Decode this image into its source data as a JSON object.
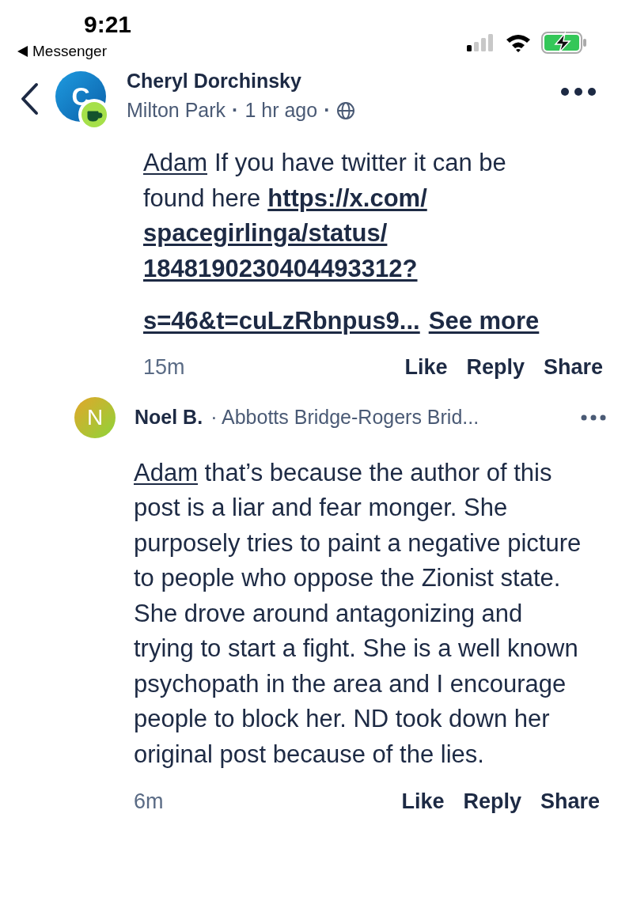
{
  "status_bar": {
    "time": "9:21",
    "back_app": "Messenger"
  },
  "post_header": {
    "avatar_letter": "C",
    "author": "Cheryl Dorchinsky",
    "location": "Milton Park",
    "separator_1": "·",
    "time": "1 hr ago",
    "separator_2": "·"
  },
  "comments": [
    {
      "kind": "reply_lines",
      "lines": [
        [
          {
            "kind": "mention",
            "text": "Adam"
          },
          {
            "kind": "text",
            "text": "If you have twitter it can be"
          }
        ],
        [
          {
            "kind": "text",
            "text": "found here"
          },
          {
            "kind": "link",
            "text": "https://x.com/"
          }
        ],
        [
          {
            "kind": "link",
            "text": "spacegirlinga/status/"
          }
        ],
        [
          {
            "kind": "link",
            "text": "1848190230404493312?"
          }
        ],
        [
          {
            "kind": "link",
            "text": "s=46&t=cuLzRbnpus9..."
          },
          {
            "kind": "more",
            "text": "See more"
          }
        ]
      ],
      "time": "15m",
      "actions": [
        "Like",
        "Reply",
        "Share"
      ]
    },
    {
      "kind": "comment",
      "avatar_letter": "N",
      "author": "Noel B.",
      "location": "· Abbotts Bridge-Rogers Brid...",
      "mention": "Adam",
      "text": "that’s because the author of this post is a liar and fear monger. She purposely tries to paint a negative picture to people who oppose the Zionist state. She drove around antagonizing and trying to start a fight. She is a well known psychopath in the area and I encourage people to block her. ND took down her original post because of the lies.",
      "time": "6m",
      "actions": [
        "Like",
        "Reply",
        "Share"
      ]
    }
  ]
}
